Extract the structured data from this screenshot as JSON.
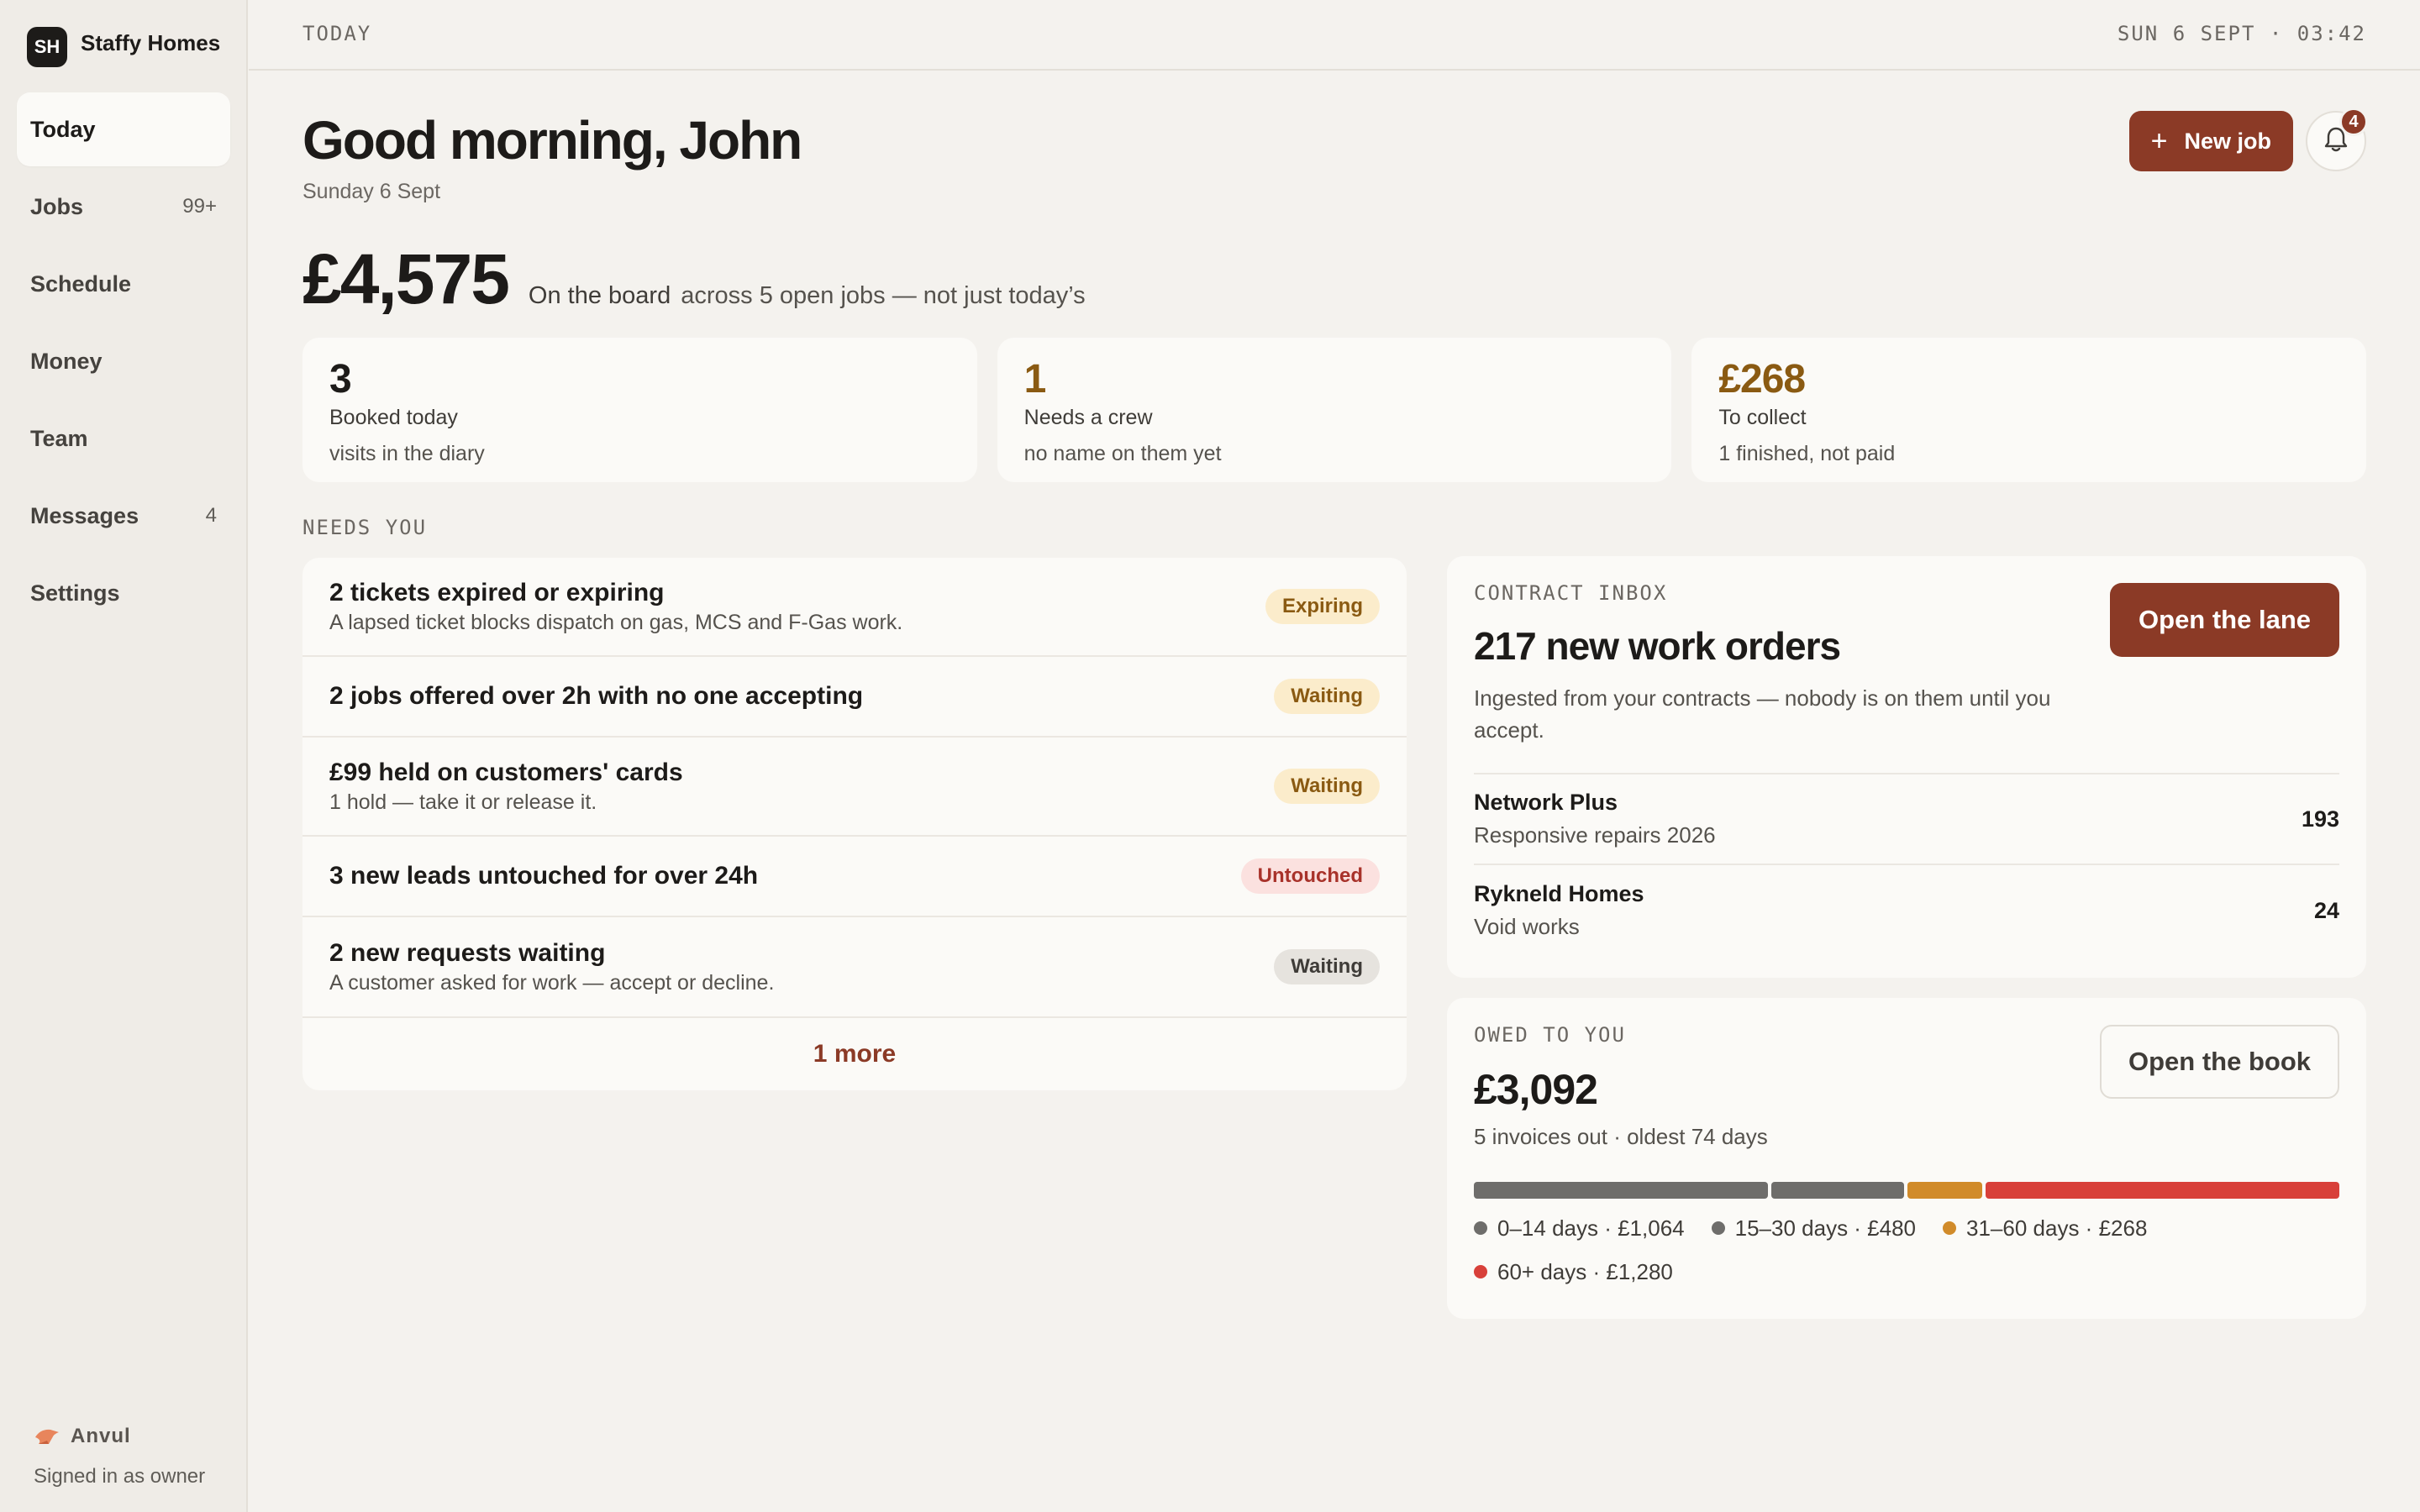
{
  "brand": {
    "initials": "SH",
    "name": "Staffy Homes"
  },
  "nav": [
    {
      "label": "Today",
      "count": "",
      "active": true
    },
    {
      "label": "Jobs",
      "count": "99+"
    },
    {
      "label": "Schedule",
      "count": ""
    },
    {
      "label": "Money",
      "count": ""
    },
    {
      "label": "Team",
      "count": ""
    },
    {
      "label": "Messages",
      "count": "4"
    },
    {
      "label": "Settings",
      "count": ""
    }
  ],
  "footer": {
    "product": "Anvul",
    "signed_in": "Signed in as owner"
  },
  "topbar": {
    "section": "TODAY",
    "datetime": "SUN 6 SEPT · 03:42"
  },
  "header": {
    "greeting": "Good morning, John",
    "date": "Sunday 6 Sept",
    "new_job_label": "New job",
    "notifications_count": "4"
  },
  "board": {
    "amount": "£4,575",
    "label": "On the board",
    "sub": "across 5 open jobs — not just today’s"
  },
  "stats": [
    {
      "value": "3",
      "label": "Booked today",
      "sub": "visits in the diary",
      "color": "#1d1b19"
    },
    {
      "value": "1",
      "label": "Needs a crew",
      "sub": "no name on them yet",
      "color": "#8a5a12"
    },
    {
      "value": "£268",
      "label": "To collect",
      "sub": "1 finished, not paid",
      "color": "#8a5a12"
    }
  ],
  "needs": {
    "section_label": "NEEDS YOU",
    "items": [
      {
        "title": "2 tickets expired or expiring",
        "desc": "A lapsed ticket blocks dispatch on gas, MCS and F-Gas work.",
        "badge": "Expiring",
        "tone": "amber"
      },
      {
        "title": "2 jobs offered over 2h with no one accepting",
        "desc": "",
        "badge": "Waiting",
        "tone": "amber"
      },
      {
        "title": "£99 held on customers' cards",
        "desc": "1 hold — take it or release it.",
        "badge": "Waiting",
        "tone": "amber"
      },
      {
        "title": "3 new leads untouched for over 24h",
        "desc": "",
        "badge": "Untouched",
        "tone": "red"
      },
      {
        "title": "2 new requests waiting",
        "desc": "A customer asked for work — accept or decline.",
        "badge": "Waiting",
        "tone": "grey"
      }
    ],
    "more_label": "1 more"
  },
  "inbox": {
    "label": "CONTRACT INBOX",
    "title": "217 new work orders",
    "desc": "Ingested from your contracts — nobody is on them until you accept.",
    "button": "Open the lane",
    "contracts": [
      {
        "name": "Network Plus",
        "sub": "Responsive repairs 2026",
        "count": "193"
      },
      {
        "name": "Rykneld Homes",
        "sub": "Void works",
        "count": "24"
      }
    ]
  },
  "owed": {
    "label": "OWED TO YOU",
    "amount": "£3,092",
    "sub": "5 invoices out · oldest 74 days",
    "button": "Open the book",
    "buckets": [
      {
        "label": "0–14 days · £1,064",
        "value": 1064,
        "color": "#6e6d6b"
      },
      {
        "label": "15–30 days · £480",
        "value": 480,
        "color": "#6e6d6b"
      },
      {
        "label": "31–60 days · £268",
        "value": 268,
        "color": "#d18b2a"
      },
      {
        "label": "60+ days · £1,280",
        "value": 1280,
        "color": "#d8403a"
      }
    ]
  }
}
